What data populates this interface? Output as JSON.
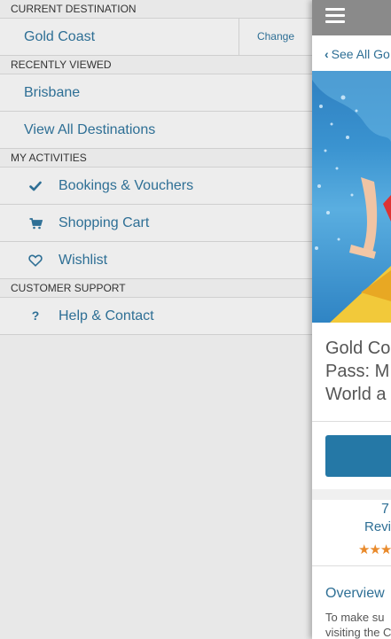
{
  "menu": {
    "current_destination": {
      "heading": "CURRENT DESTINATION",
      "value": "Gold Coast",
      "change_label": "Change"
    },
    "recently_viewed": {
      "heading": "RECENTLY VIEWED",
      "items": [
        {
          "label": "Brisbane"
        },
        {
          "label": "View All Destinations"
        }
      ]
    },
    "my_activities": {
      "heading": "MY ACTIVITIES",
      "items": [
        {
          "label": "Bookings & Vouchers",
          "icon": "check-icon"
        },
        {
          "label": "Shopping Cart",
          "icon": "cart-icon"
        },
        {
          "label": "Wishlist",
          "icon": "heart-icon"
        }
      ]
    },
    "customer_support": {
      "heading": "CUSTOMER SUPPORT",
      "items": [
        {
          "label": "Help & Contact",
          "icon": "question-icon"
        }
      ]
    }
  },
  "preview": {
    "back_link": "See All Go",
    "title_lines": [
      "Gold Co",
      "Pass: M",
      "World a"
    ],
    "reviews_count": "7",
    "reviews_label": "Revi",
    "stars": "★★★",
    "overview_label": "Overview",
    "body_lines": [
      "To make su",
      "visiting the C"
    ]
  },
  "colors": {
    "accent": "#2e6f95",
    "button": "#2578a6",
    "star": "#e98a2b",
    "topbar": "#8a8a8a"
  }
}
